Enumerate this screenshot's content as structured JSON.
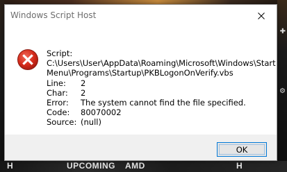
{
  "window": {
    "title": "Windows Script Host",
    "close_icon": "close-icon"
  },
  "message": {
    "icon": "error-icon",
    "script_label": "Script:",
    "script_path_line1": "C:\\Users\\User\\AppData\\Roaming\\Microsoft\\Windows\\Start",
    "script_path_line2": "Menu\\Programs\\Startup\\PKBLogonOnVerify.vbs",
    "fields": [
      {
        "label": "Line:",
        "value": "2"
      },
      {
        "label": "Char:",
        "value": "2"
      },
      {
        "label": "Error:",
        "value": "The system cannot find the file specified."
      },
      {
        "label": "Code:",
        "value": "80070002"
      },
      {
        "label": "Source:",
        "value": "(null)"
      }
    ]
  },
  "buttons": {
    "ok_label": "OK"
  },
  "background": {
    "text_left": "H",
    "text_upcoming": "UPCOMING",
    "text_amd": "AMD",
    "text_right": "H"
  },
  "colors": {
    "accent": "#0078d7",
    "error_red": "#c42b1c"
  }
}
